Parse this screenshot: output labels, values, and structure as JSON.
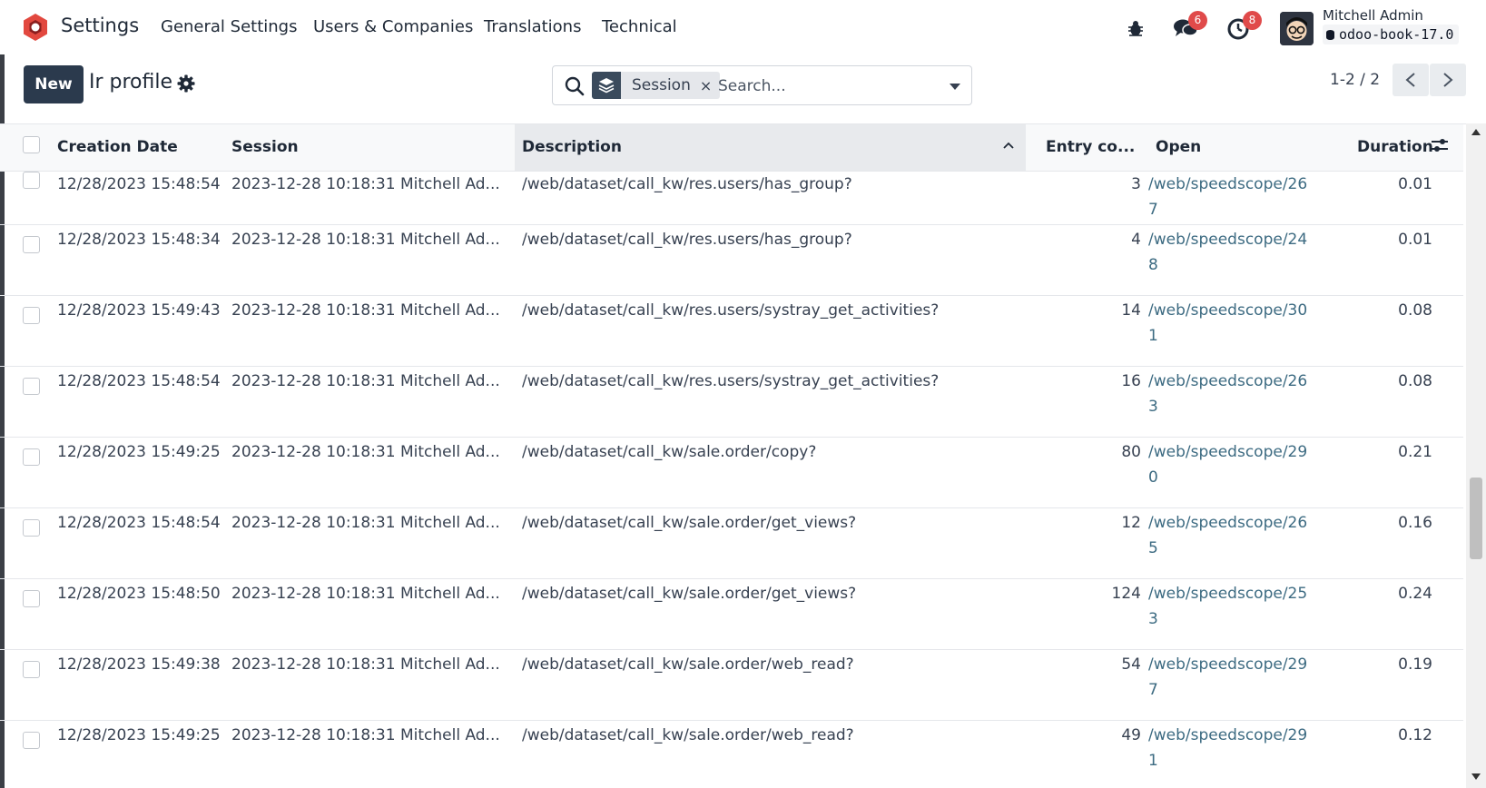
{
  "navbar": {
    "app_title": "Settings",
    "menu": [
      "General Settings",
      "Users & Companies",
      "Translations",
      "Technical"
    ],
    "messages_count": "6",
    "activities_count": "8",
    "user_name": "Mitchell Admin",
    "database": "odoo-book-17.0"
  },
  "control_panel": {
    "new_label": "New",
    "breadcrumb": "Ir profile",
    "search": {
      "facet_label": "Session",
      "facet_remove": "×",
      "placeholder": "Search..."
    },
    "pager": "1-2 / 2"
  },
  "list": {
    "columns": [
      "Creation Date",
      "Session",
      "Description",
      "Entry co...",
      "Open",
      "Duration"
    ],
    "rows": [
      {
        "creation_date": "12/28/2023 15:48:54",
        "session": "2023-12-28 10:18:31 Mitchell Ad...",
        "description": "/web/dataset/call_kw/res.users/has_group?",
        "entry_count": "3",
        "open": "/web/speedscope/267",
        "duration": "0.01"
      },
      {
        "creation_date": "12/28/2023 15:48:34",
        "session": "2023-12-28 10:18:31 Mitchell Ad...",
        "description": "/web/dataset/call_kw/res.users/has_group?",
        "entry_count": "4",
        "open": "/web/speedscope/248",
        "duration": "0.01"
      },
      {
        "creation_date": "12/28/2023 15:49:43",
        "session": "2023-12-28 10:18:31 Mitchell Ad...",
        "description": "/web/dataset/call_kw/res.users/systray_get_activities?",
        "entry_count": "14",
        "open": "/web/speedscope/301",
        "duration": "0.08"
      },
      {
        "creation_date": "12/28/2023 15:48:54",
        "session": "2023-12-28 10:18:31 Mitchell Ad...",
        "description": "/web/dataset/call_kw/res.users/systray_get_activities?",
        "entry_count": "16",
        "open": "/web/speedscope/263",
        "duration": "0.08"
      },
      {
        "creation_date": "12/28/2023 15:49:25",
        "session": "2023-12-28 10:18:31 Mitchell Ad...",
        "description": "/web/dataset/call_kw/sale.order/copy?",
        "entry_count": "80",
        "open": "/web/speedscope/290",
        "duration": "0.21"
      },
      {
        "creation_date": "12/28/2023 15:48:54",
        "session": "2023-12-28 10:18:31 Mitchell Ad...",
        "description": "/web/dataset/call_kw/sale.order/get_views?",
        "entry_count": "12",
        "open": "/web/speedscope/265",
        "duration": "0.16"
      },
      {
        "creation_date": "12/28/2023 15:48:50",
        "session": "2023-12-28 10:18:31 Mitchell Ad...",
        "description": "/web/dataset/call_kw/sale.order/get_views?",
        "entry_count": "124",
        "open": "/web/speedscope/253",
        "duration": "0.24"
      },
      {
        "creation_date": "12/28/2023 15:49:38",
        "session": "2023-12-28 10:18:31 Mitchell Ad...",
        "description": "/web/dataset/call_kw/sale.order/web_read?",
        "entry_count": "54",
        "open": "/web/speedscope/297",
        "duration": "0.19"
      },
      {
        "creation_date": "12/28/2023 15:49:25",
        "session": "2023-12-28 10:18:31 Mitchell Ad...",
        "description": "/web/dataset/call_kw/sale.order/web_read?",
        "entry_count": "49",
        "open": "/web/speedscope/291",
        "duration": "0.12"
      }
    ]
  },
  "colors": {
    "brand": "#e2483f",
    "primary_button": "#2b3a4d",
    "link": "#3d6b82",
    "badge": "#e04a4a"
  }
}
